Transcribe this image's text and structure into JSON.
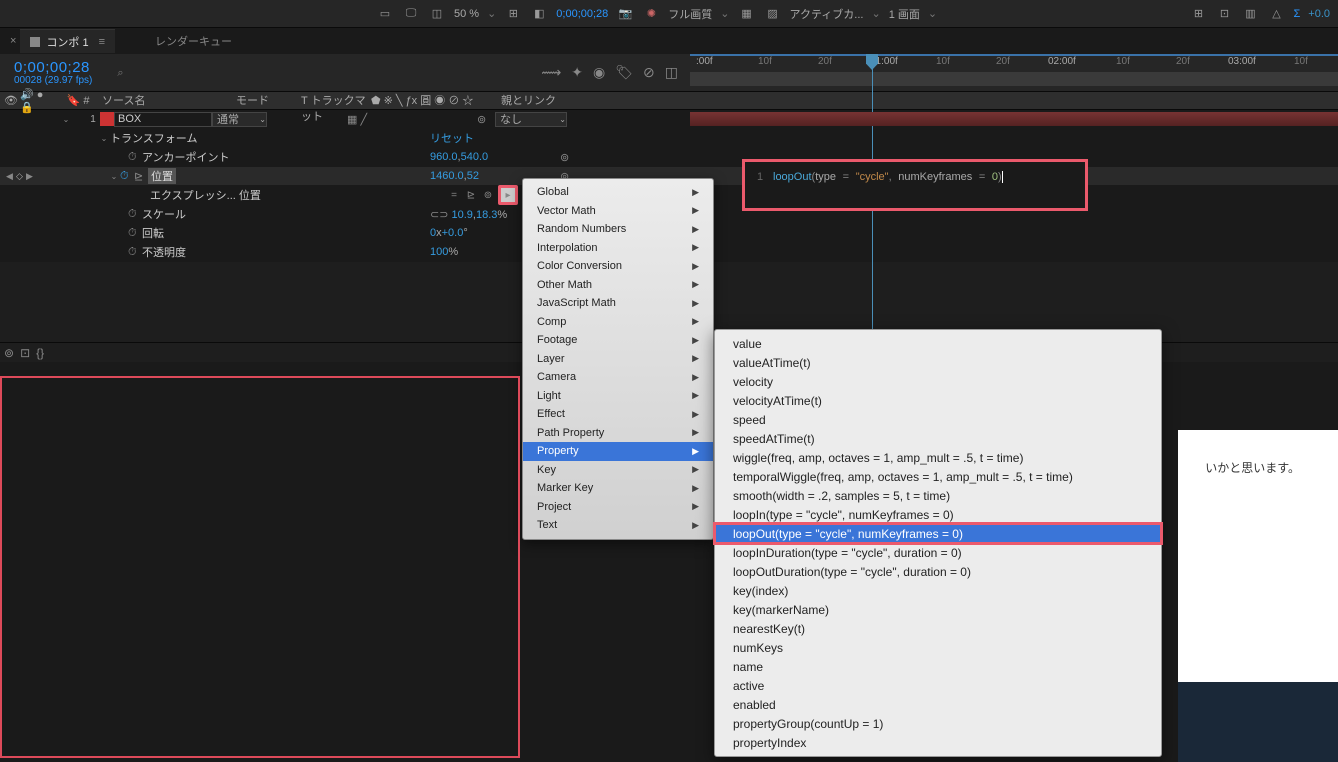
{
  "toolbar": {
    "zoom": "50 %",
    "timecode": "0;00;00;28",
    "view_mode": "フル画質",
    "camera": "アクティブカ...",
    "screens": "1 画面",
    "sigma": "Σ",
    "plus0": "+0.0"
  },
  "tabs": {
    "comp": "コンポ 1",
    "render": "レンダーキュー"
  },
  "timeline": {
    "timecode": "0;00;00;28",
    "framerate": "00028 (29.97 fps)",
    "search_placeholder": "⌕",
    "ruler": [
      ":00f",
      "10f",
      "20f",
      "01:00f",
      "10f",
      "20f",
      "02:00f",
      "10f",
      "20f",
      "03:00f",
      "10f"
    ]
  },
  "columns": {
    "src": "ソース名",
    "mode": "モード",
    "track": "T トラックマット",
    "switches": "⬟ ※ ╲ ƒx 圓 ◉ ⊘ ☆",
    "parent": "親とリンク"
  },
  "layer": {
    "num": "1",
    "name": "BOX",
    "mode": "通常",
    "parent": "なし"
  },
  "props": {
    "transform": "トランスフォーム",
    "reset": "リセット",
    "anchor": "アンカーポイント",
    "anchor_val_a": "960.0",
    "anchor_val_b": "540.0",
    "position": "位置",
    "position_val_a": "1460.0",
    "position_val_b": "52",
    "expression": "エクスプレッシ... 位置",
    "scale": "スケール",
    "scale_val_a": "10.9",
    "scale_val_b": "18.3",
    "scale_unit": "%",
    "rotation": "回転",
    "rotation_val_a": "0",
    "rotation_val_b": "+0.0",
    "rotation_unit": "°",
    "opacity": "不透明度",
    "opacity_val": "100",
    "opacity_unit": "%"
  },
  "expression": {
    "line": "1",
    "code_fn": "loopOut",
    "code_type": "type",
    "code_str": "\"cycle\"",
    "code_nk": "numKeyframes",
    "code_zero": "0"
  },
  "menu1": {
    "items": [
      "Global",
      "Vector Math",
      "Random Numbers",
      "Interpolation",
      "Color Conversion",
      "Other Math",
      "JavaScript Math",
      "Comp",
      "Footage",
      "Layer",
      "Camera",
      "Light",
      "Effect",
      "Path Property",
      "Property",
      "Key",
      "Marker Key",
      "Project",
      "Text"
    ],
    "selected": 14
  },
  "menu2": {
    "items": [
      "value",
      "valueAtTime(t)",
      "velocity",
      "velocityAtTime(t)",
      "speed",
      "speedAtTime(t)",
      "wiggle(freq, amp, octaves = 1, amp_mult = .5, t = time)",
      "temporalWiggle(freq, amp, octaves = 1, amp_mult = .5, t = time)",
      "smooth(width = .2, samples = 5, t = time)",
      "loopIn(type = \"cycle\", numKeyframes = 0)",
      "loopOut(type = \"cycle\", numKeyframes = 0)",
      "loopInDuration(type = \"cycle\", duration = 0)",
      "loopOutDuration(type = \"cycle\", duration = 0)",
      "key(index)",
      "key(markerName)",
      "nearestKey(t)",
      "numKeys",
      "name",
      "active",
      "enabled",
      "propertyGroup(countUp = 1)",
      "propertyIndex"
    ],
    "selected": 10
  },
  "rightside": "いかと思います。"
}
